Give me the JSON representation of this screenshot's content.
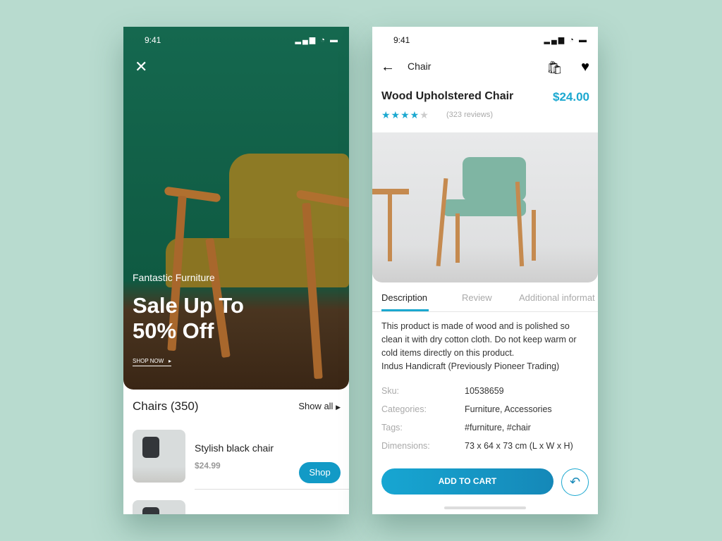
{
  "colors": {
    "background": "#b8dbcf",
    "accent": "#1ba8d0",
    "hero_green": "#15684f"
  },
  "left": {
    "status": {
      "time": "9:41",
      "icons": "signal wifi battery"
    },
    "close_icon": "close-icon",
    "hero": {
      "subtitle": "Fantastic Furniture",
      "title": "Sale Up To 50% Off",
      "cta": "SHOP NOW"
    },
    "section": {
      "title": "Chairs (350)",
      "show_all": "Show all"
    },
    "items": [
      {
        "name": "Stylish black chair",
        "price": "$24.99",
        "button": "Shop"
      }
    ]
  },
  "right": {
    "status": {
      "time": "9:41"
    },
    "nav": {
      "title": "Chair",
      "icons": [
        "back-arrow-icon",
        "shopping-bag-icon",
        "heart-icon"
      ]
    },
    "product": {
      "name": "Wood Upholstered Chair",
      "price": "$24.00",
      "rating": 4,
      "rating_max": 5,
      "reviews": "(323 reviews)"
    },
    "tabs": [
      "Description",
      "Review",
      "Additional informat"
    ],
    "active_tab": 0,
    "description": "This product is made of wood and is polished so clean it with dry cotton cloth. Do not keep warm or cold items directly on this product.",
    "brand_line": "Indus Handicraft (Previously Pioneer Trading)",
    "specs": [
      {
        "key": "Sku:",
        "value": "10538659"
      },
      {
        "key": "Categories:",
        "value": "Furniture, Accessories"
      },
      {
        "key": "Tags:",
        "value": "#furniture, #chair"
      },
      {
        "key": "Dimensions:",
        "value": "73 x 64 x 73 cm (L x W x H)"
      }
    ],
    "add_to_cart": "ADD TO CART"
  }
}
